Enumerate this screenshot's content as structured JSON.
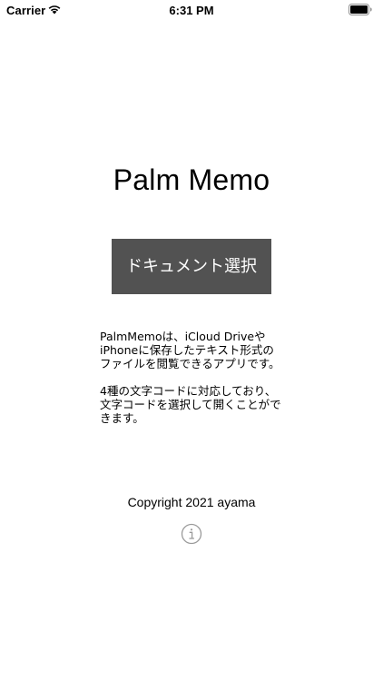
{
  "status_bar": {
    "carrier": "Carrier",
    "time": "6:31 PM"
  },
  "main": {
    "title": "Palm Memo",
    "select_button_label": "ドキュメント選択",
    "description_lines_1": "PalmMemoは、iCloud Driveや\niPhoneに保存したテキスト形式の\nファイルを閲覧できるアプリです。",
    "description_lines_2": "4種の文字コードに対応しており、\n文字コードを選択して開くことがで\nきます。",
    "copyright": "Copyright 2021 ayama"
  },
  "icons": {
    "wifi": "wifi-icon",
    "battery": "battery-icon",
    "info": "info-icon"
  },
  "colors": {
    "button_background": "#525252",
    "button_text": "#ffffff",
    "info_icon": "#9a9a9a"
  }
}
